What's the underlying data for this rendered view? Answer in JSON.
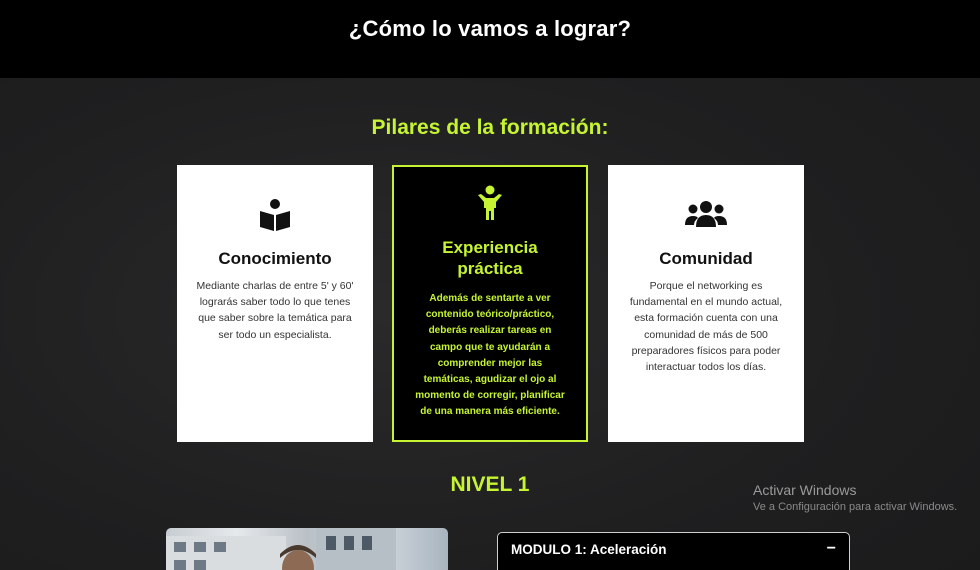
{
  "header": {
    "title": "¿Cómo lo vamos a lograr?"
  },
  "pillars": {
    "title": "Pilares de la formación:",
    "cards": [
      {
        "icon": "book-reader-icon",
        "heading": "Conocimiento",
        "body": "Mediante charlas de entre 5' y 60' lograrás saber todo lo que tenes que saber sobre la temática para ser todo un especialista."
      },
      {
        "icon": "child-figure-icon",
        "heading": "Experiencia práctica",
        "body": "Además de sentarte a ver contenido teórico/práctico, deberás realizar tareas en campo que te ayudarán a comprender mejor las temáticas, agudizar el ojo al momento de corregir, planificar de una manera más eficiente."
      },
      {
        "icon": "users-group-icon",
        "heading": "Comunidad",
        "body": "Porque el networking es fundamental en el mundo actual, esta formación cuenta con una comunidad de más de 500 preparadores físicos para poder interactuar todos los días."
      }
    ]
  },
  "level": {
    "title": "NIVEL 1"
  },
  "modules": [
    {
      "label": "MODULO 1: Aceleración",
      "toggle": "−"
    }
  ],
  "watermark": {
    "title": "Activar Windows",
    "subtitle": "Ve a Configuración para activar Windows."
  },
  "colors": {
    "accent": "#c6f432",
    "background": "#1f1f20",
    "header_band": "#000000",
    "card_light": "#ffffff"
  }
}
